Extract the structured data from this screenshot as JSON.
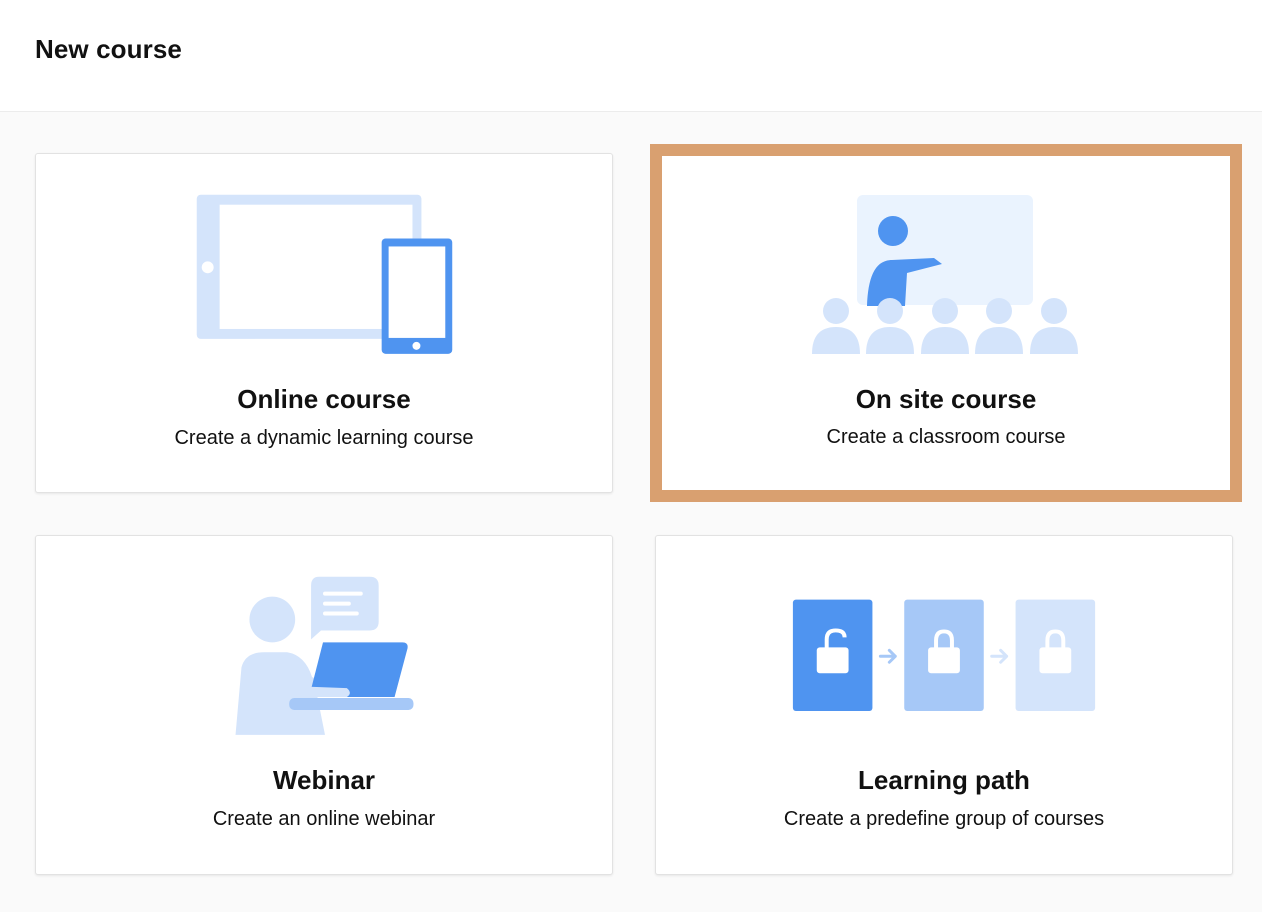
{
  "header": {
    "title": "New course"
  },
  "cards": [
    {
      "title": "Online course",
      "description": "Create a dynamic learning course",
      "icon": "tablet-phone-icon",
      "selected": false
    },
    {
      "title": "On site course",
      "description": "Create a classroom course",
      "icon": "classroom-icon",
      "selected": true
    },
    {
      "title": "Webinar",
      "description": "Create an online webinar",
      "icon": "webinar-icon",
      "selected": false
    },
    {
      "title": "Learning path",
      "description": "Create a predefine group of courses",
      "icon": "learning-path-icon",
      "selected": false
    }
  ],
  "colors": {
    "accent_blue": "#4f94f0",
    "light_blue": "#d4e4fb",
    "mid_blue": "#a6c8f7",
    "selection_border": "#d9a070"
  }
}
